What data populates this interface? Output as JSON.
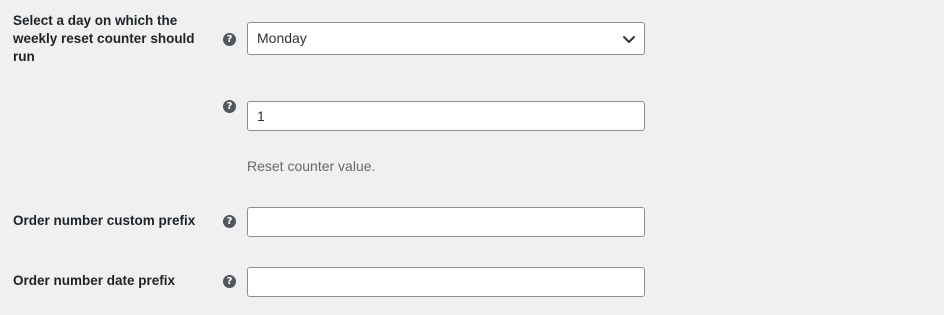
{
  "weekly_reset": {
    "label": "Select a day on which the weekly reset counter should run",
    "help": "?",
    "selected": "Monday"
  },
  "reset_counter": {
    "help": "?",
    "value": "1",
    "description": "Reset counter value."
  },
  "custom_prefix": {
    "label": "Order number custom prefix",
    "help": "?",
    "value": ""
  },
  "date_prefix": {
    "label": "Order number date prefix",
    "help": "?",
    "value": ""
  }
}
